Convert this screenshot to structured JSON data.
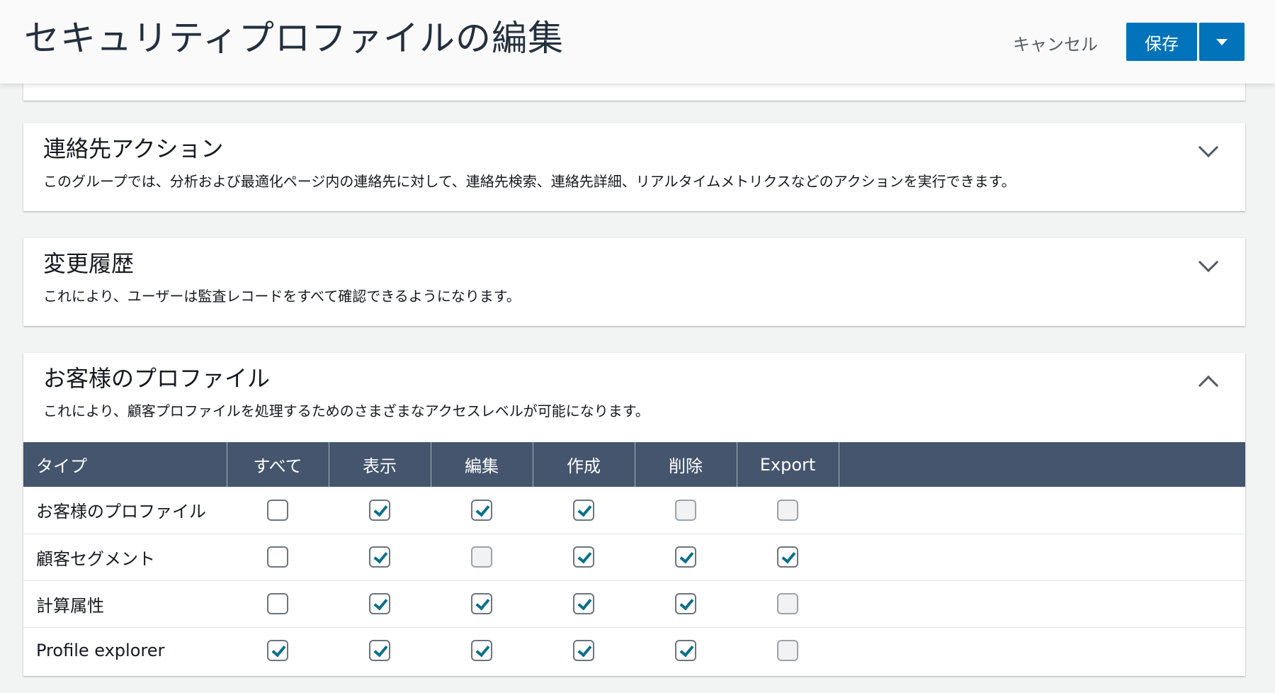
{
  "header": {
    "title": "セキュリティプロファイルの編集",
    "cancel_label": "キャンセル",
    "save_label": "保存"
  },
  "colors": {
    "primary": "#0073bb",
    "table_header": "#44556d",
    "check": "#0a6f8c"
  },
  "sections": [
    {
      "title": "連絡先アクション",
      "description": "このグループでは、分析および最適化ページ内の連絡先に対して、連絡先検索、連絡先詳細、リアルタイムメトリクスなどのアクションを実行できます。",
      "expanded": false,
      "icon": "chevron-down-icon"
    },
    {
      "title": "変更履歴",
      "description": "これにより、ユーザーは監査レコードをすべて確認できるようになります。",
      "expanded": false,
      "icon": "chevron-down-icon"
    },
    {
      "title": "お客様のプロファイル",
      "description": "これにより、顧客プロファイルを処理するためのさまざまなアクセスレベルが可能になります。",
      "expanded": true,
      "icon": "chevron-up-icon",
      "table": {
        "headers": [
          "タイプ",
          "すべて",
          "表示",
          "編集",
          "作成",
          "削除",
          "Export"
        ],
        "rows": [
          {
            "type": "お客様のプロファイル",
            "cells": [
              "unchecked",
              "checked",
              "checked",
              "checked",
              "disabled",
              "disabled"
            ]
          },
          {
            "type": "顧客セグメント",
            "cells": [
              "unchecked",
              "checked",
              "disabled",
              "checked",
              "checked",
              "checked"
            ]
          },
          {
            "type": "計算属性",
            "cells": [
              "unchecked",
              "checked",
              "checked",
              "checked",
              "checked",
              "disabled"
            ]
          },
          {
            "type": "Profile explorer",
            "cells": [
              "checked",
              "checked",
              "checked",
              "checked",
              "checked",
              "disabled"
            ]
          }
        ]
      }
    }
  ]
}
